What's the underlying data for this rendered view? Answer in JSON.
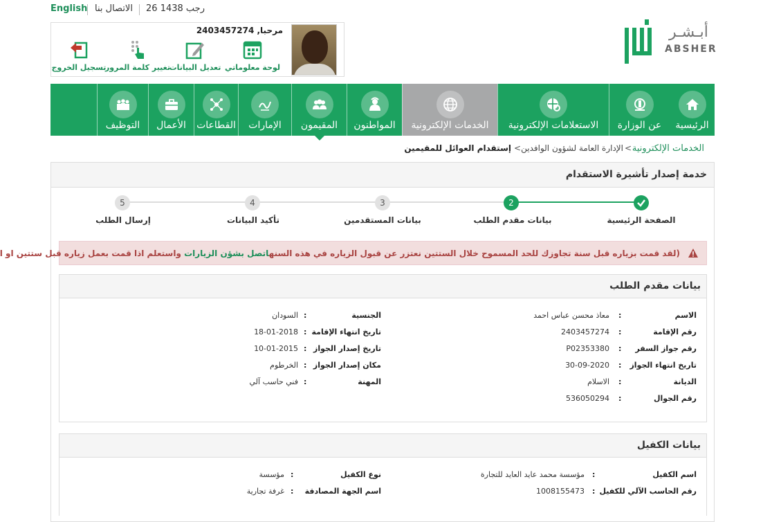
{
  "topbar": {
    "english": "English",
    "contact": "الاتصال بنا",
    "date": "26 رجب 1438"
  },
  "user": {
    "welcome": "مرحبا, 2403457274",
    "actions": {
      "dashboard": "لوحة معلوماتي",
      "edit_data": "تعديل البيانات",
      "change_password": "تغيير كلمة المرور",
      "logout": "تسجيل الخروج"
    }
  },
  "logo": {
    "ar": "أبـشـر",
    "en": "ABSHER"
  },
  "nav": {
    "home": "الرئيسية",
    "ministry": "عن الوزارة",
    "inquiries": "الاستعلامات الإلكترونية",
    "eservices": "الخدمات الإلكترونية",
    "citizens": "المواطنون",
    "residents": "المقيمون",
    "emirates": "الإمارات",
    "sectors": "القطاعات",
    "business": "الأعمال",
    "employment": "التوظيف"
  },
  "breadcrumb": {
    "c1": "الخدمات الإلكترونية",
    "c2": "الإدارة العامة لشؤون الوافدين",
    "c3": "إستقدام العوائل للمقيمين"
  },
  "page_title": "خدمة إصدار تأشيرة الاستقدام",
  "steps": [
    {
      "num": "1",
      "label": "الصفحة الرئيسية"
    },
    {
      "num": "2",
      "label": "بيانات مقدم الطلب"
    },
    {
      "num": "3",
      "label": "بيانات المستقدمين"
    },
    {
      "num": "4",
      "label": "تأكيد البيانات"
    },
    {
      "num": "5",
      "label": "إرسال الطلب"
    }
  ],
  "alert": {
    "part1": "لقد قمت بزياره قبل سنة تجاوزك للحد المسموح خلال الستتين نعتزر عن قبول الزياره في هذه السنه",
    "part2": "اتصل بشؤن الزيارات",
    "part3": " واستعلم اذا قمت بعمل زياره قبل ستتين او اكثر)"
  },
  "applicant": {
    "title": "بيانات مقدم الطلب",
    "right": [
      {
        "label": "الاسم",
        "value": "معاذ محسن عباس احمد"
      },
      {
        "label": "رقم الإقامة",
        "value": "2403457274"
      },
      {
        "label": "رقم جواز السفر",
        "value": "P02353380"
      },
      {
        "label": "تاريخ انتهاء الجواز",
        "value": "30-09-2020"
      },
      {
        "label": "الديانة",
        "value": "الاسلام"
      },
      {
        "label": "رقم الجوال",
        "value": "536050294"
      }
    ],
    "left": [
      {
        "label": "الجنسية",
        "value": "السودان"
      },
      {
        "label": "تاريخ انتهاء الإقامة",
        "value": "18-01-2018"
      },
      {
        "label": "تاريخ إصدار الجواز",
        "value": "10-01-2015"
      },
      {
        "label": "مكان إصدار الجواز",
        "value": "الخرطوم"
      },
      {
        "label": "المهنة",
        "value": "فني حاسب آلي"
      }
    ]
  },
  "sponsor": {
    "title": "بيانات الكفيل",
    "right": [
      {
        "label": "اسم الكفيل",
        "value": "مؤسسة محمد عايد العايد للتجارة"
      },
      {
        "label": "رقم الحاسب الآلي للكفيل",
        "value": "1008155473"
      }
    ],
    "left": [
      {
        "label": "نوع الكفيل",
        "value": "مؤسسة"
      },
      {
        "label": "اسم الجهة المصادقة",
        "value": "غرفة تجارية"
      }
    ]
  },
  "colors": {
    "primary": "#1ca260",
    "active_tab": "#a7a8a9",
    "alert_text": "#a94442"
  }
}
